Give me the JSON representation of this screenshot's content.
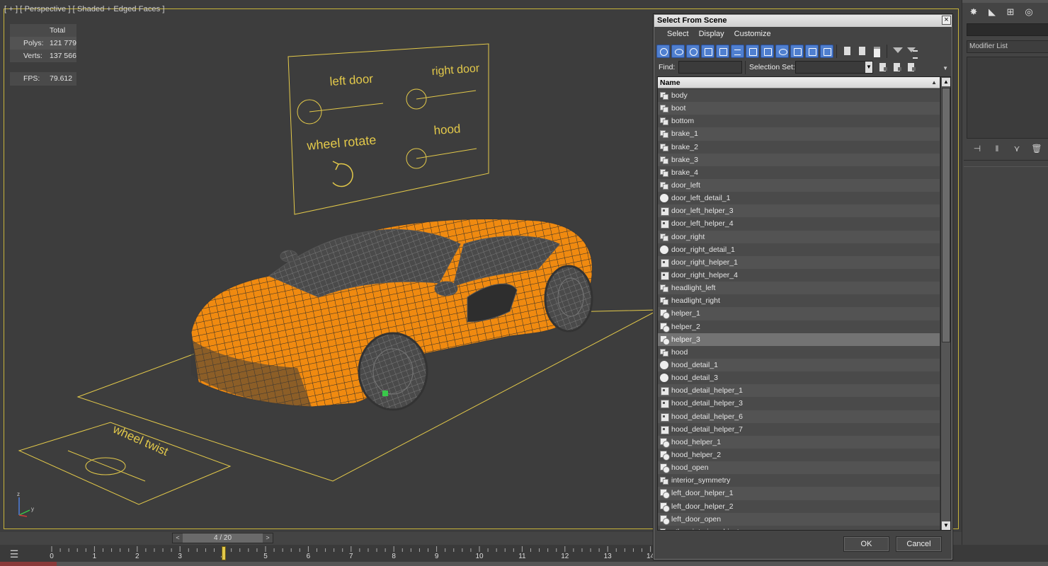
{
  "viewport": {
    "label": "[ + ] [ Perspective ] [ Shaded + Edged Faces ]",
    "stats": {
      "total_label": "Total",
      "polys_label": "Polys:",
      "polys_value": "121 779",
      "verts_label": "Verts:",
      "verts_value": "137 566",
      "fps_label": "FPS:",
      "fps_value": "79.612"
    },
    "panel_labels": {
      "left_door": "left door",
      "right_door": "right door",
      "wheel_rotate": "wheel rotate",
      "hood": "hood",
      "wheel_twist": "wheel twist"
    },
    "axis": {
      "x": "x",
      "y": "y",
      "z": "z"
    },
    "colors": {
      "car_body": "#f08a10",
      "wire": "#2b2b2b",
      "control_lines": "#e3c94a",
      "frame": "#c8b43a"
    }
  },
  "timeline": {
    "slider_prev": "<",
    "slider_next": ">",
    "position": "4 / 20",
    "ticks": [
      "0",
      "1",
      "2",
      "3",
      "4",
      "5",
      "6",
      "7",
      "8",
      "9",
      "10",
      "11",
      "12",
      "13",
      "14"
    ]
  },
  "command_panel": {
    "modifier_list": "Modifier List",
    "tabs": [
      "create-icon",
      "modify-icon",
      "hierarchy-icon",
      "motion-icon"
    ]
  },
  "dialog": {
    "title": "Select From Scene",
    "close": "×",
    "menu": [
      "Select",
      "Display",
      "Customize"
    ],
    "find_label": "Find:",
    "find_value": "",
    "selection_set_label": "Selection Set:",
    "selection_set_value": "",
    "column_name": "Name",
    "items": [
      {
        "name": "body",
        "icon": "mesh"
      },
      {
        "name": "boot",
        "icon": "mesh"
      },
      {
        "name": "bottom",
        "icon": "mesh"
      },
      {
        "name": "brake_1",
        "icon": "mesh"
      },
      {
        "name": "brake_2",
        "icon": "mesh"
      },
      {
        "name": "brake_3",
        "icon": "mesh"
      },
      {
        "name": "brake_4",
        "icon": "mesh"
      },
      {
        "name": "door_left",
        "icon": "mesh"
      },
      {
        "name": "door_left_detail_1",
        "icon": "sphere"
      },
      {
        "name": "door_left_helper_3",
        "icon": "helper"
      },
      {
        "name": "door_left_helper_4",
        "icon": "helper"
      },
      {
        "name": "door_right",
        "icon": "mesh"
      },
      {
        "name": "door_right_detail_1",
        "icon": "sphere"
      },
      {
        "name": "door_right_helper_1",
        "icon": "helper"
      },
      {
        "name": "door_right_helper_4",
        "icon": "helper"
      },
      {
        "name": "headlight_left",
        "icon": "mesh"
      },
      {
        "name": "headlight_right",
        "icon": "mesh"
      },
      {
        "name": "helper_1",
        "icon": "ctrl"
      },
      {
        "name": "helper_2",
        "icon": "ctrl"
      },
      {
        "name": "helper_3",
        "icon": "ctrl",
        "selected": true
      },
      {
        "name": "hood",
        "icon": "mesh"
      },
      {
        "name": "hood_detail_1",
        "icon": "sphere"
      },
      {
        "name": "hood_detail_3",
        "icon": "sphere"
      },
      {
        "name": "hood_detail_helper_1",
        "icon": "helper"
      },
      {
        "name": "hood_detail_helper_3",
        "icon": "helper"
      },
      {
        "name": "hood_detail_helper_6",
        "icon": "helper"
      },
      {
        "name": "hood_detail_helper_7",
        "icon": "helper"
      },
      {
        "name": "hood_helper_1",
        "icon": "ctrl"
      },
      {
        "name": "hood_helper_2",
        "icon": "ctrl"
      },
      {
        "name": "hood_open",
        "icon": "ctrl"
      },
      {
        "name": "interior_symmetry",
        "icon": "mesh"
      },
      {
        "name": "left_door_helper_1",
        "icon": "ctrl"
      },
      {
        "name": "left_door_helper_2",
        "icon": "ctrl"
      },
      {
        "name": "left_door_open",
        "icon": "ctrl"
      },
      {
        "name": "other_interior_objects",
        "icon": "mesh"
      }
    ],
    "ok_label": "OK",
    "cancel_label": "Cancel"
  }
}
